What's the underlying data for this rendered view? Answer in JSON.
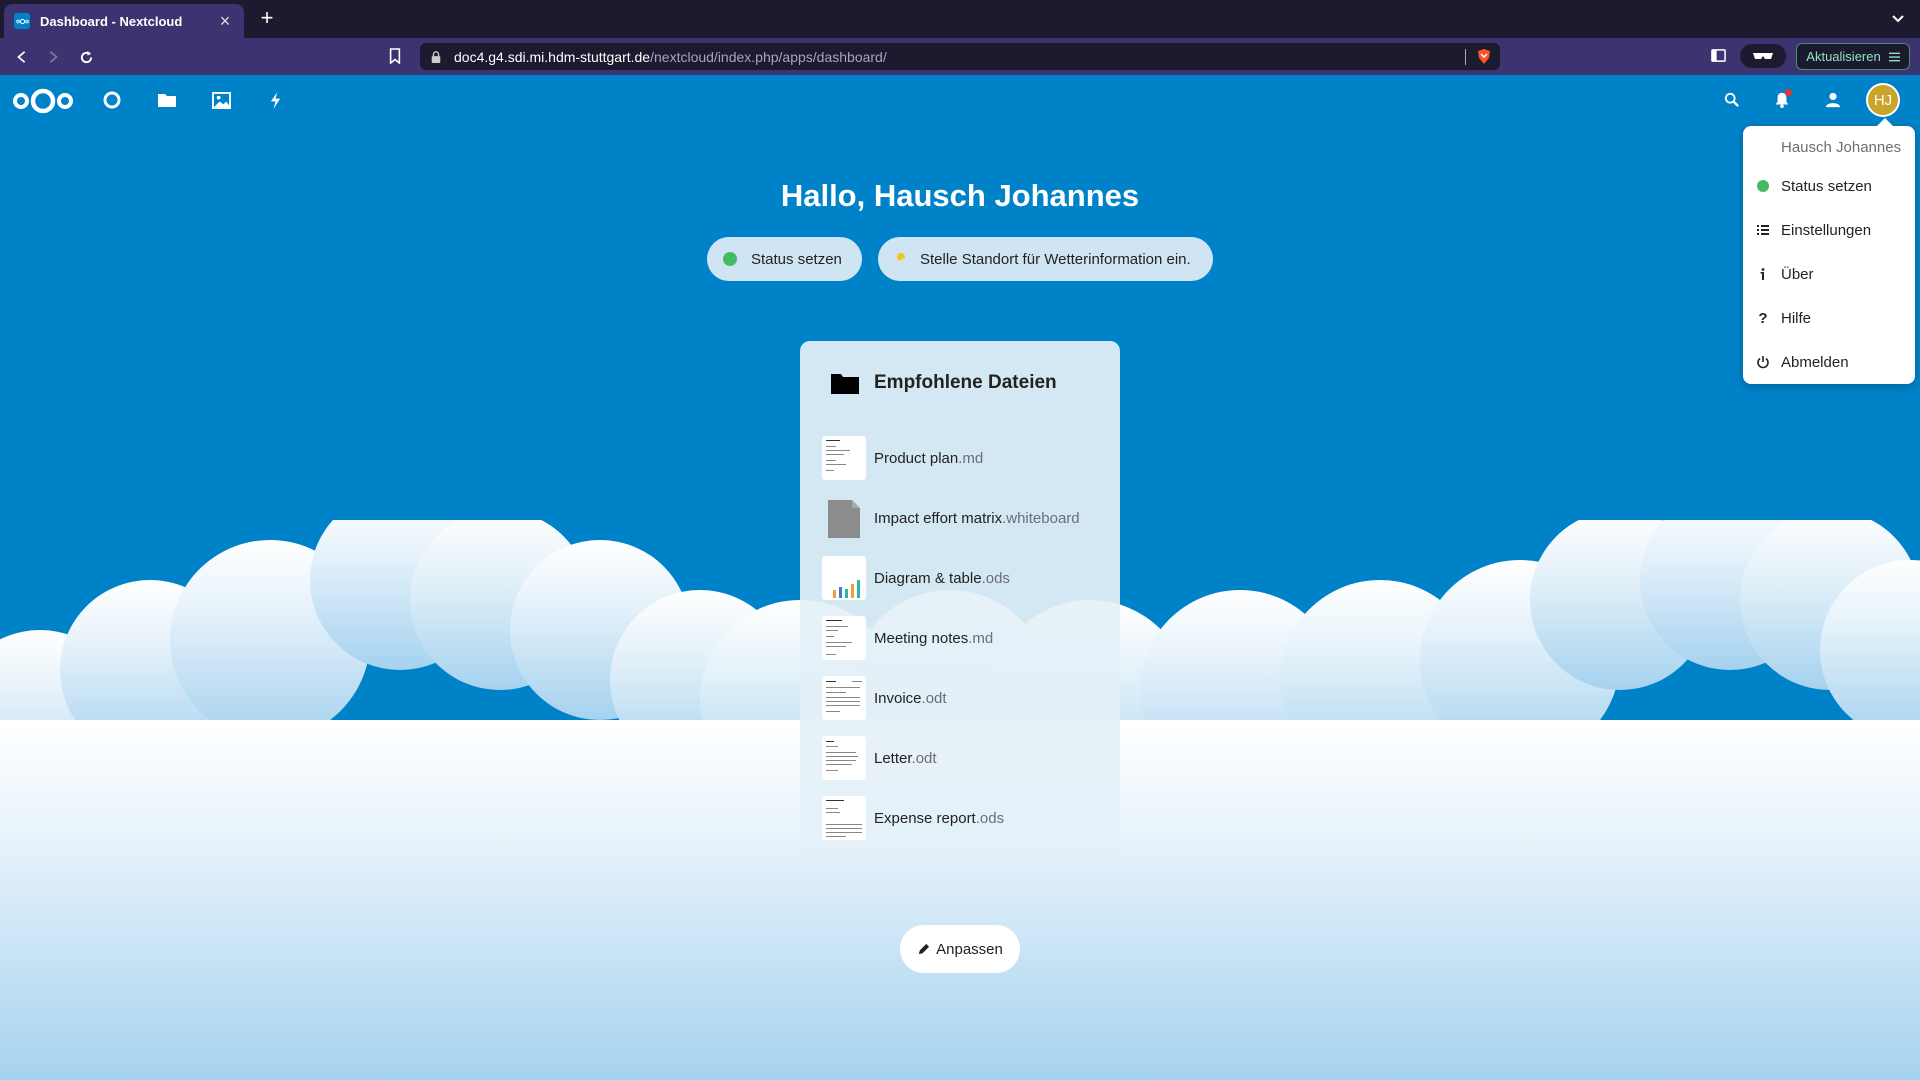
{
  "browser": {
    "tab_title": "Dashboard - Nextcloud",
    "url_host": "doc4.g4.sdi.mi.hdm-stuttgart.de",
    "url_path": "/nextcloud/index.php/apps/dashboard/",
    "update_label": "Aktualisieren"
  },
  "header": {
    "avatar_initials": "HJ"
  },
  "dashboard": {
    "greeting": "Hallo, Hausch Johannes",
    "status_label": "Status setzen",
    "weather_label": "Stelle Standort für Wetterinformation ein.",
    "customize_label": "Anpassen"
  },
  "widget": {
    "title": "Empfohlene Dateien",
    "files": [
      {
        "name": "Product plan",
        "ext": ".md"
      },
      {
        "name": "Impact effort matrix",
        "ext": ".whiteboard"
      },
      {
        "name": "Diagram & table",
        "ext": ".ods"
      },
      {
        "name": "Meeting notes",
        "ext": ".md"
      },
      {
        "name": "Invoice",
        "ext": ".odt"
      },
      {
        "name": "Letter",
        "ext": ".odt"
      },
      {
        "name": "Expense report",
        "ext": ".ods"
      }
    ]
  },
  "user_menu": {
    "user_name": "Hausch Johannes",
    "items": [
      {
        "label": "Status setzen",
        "icon": "online-status-icon"
      },
      {
        "label": "Einstellungen",
        "icon": "settings-list-icon"
      },
      {
        "label": "Über",
        "icon": "info-icon"
      },
      {
        "label": "Hilfe",
        "icon": "help-icon"
      },
      {
        "label": "Abmelden",
        "icon": "power-icon"
      }
    ]
  },
  "colors": {
    "brand": "#0082c9",
    "status_online": "#46ba61",
    "avatar_bg": "#c9a52c"
  }
}
